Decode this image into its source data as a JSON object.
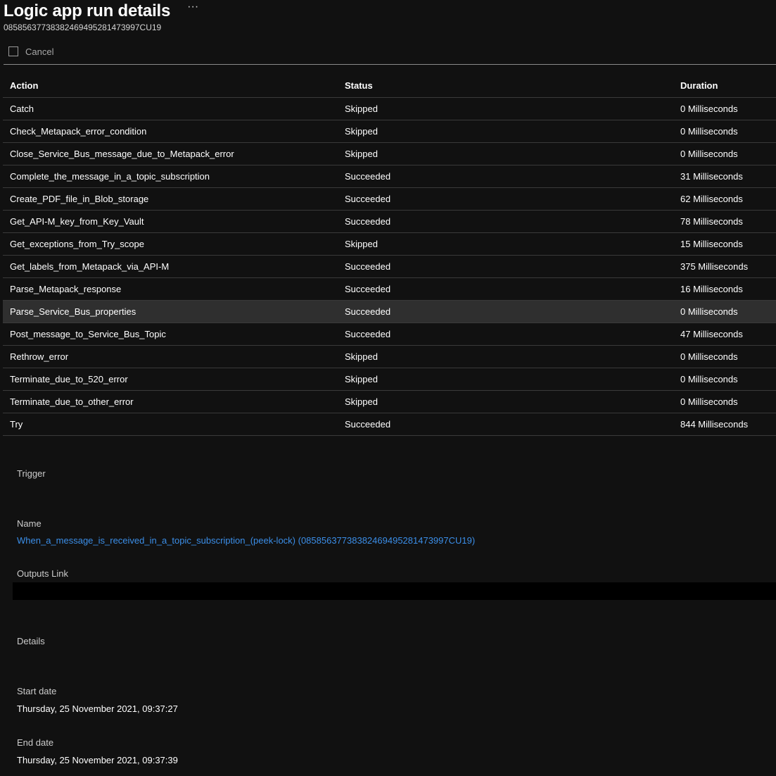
{
  "header": {
    "title": "Logic app run details",
    "more_label": "···",
    "run_id": "08585637738382469495281473997CU19"
  },
  "toolbar": {
    "cancel_label": "Cancel"
  },
  "table": {
    "columns": [
      "Action",
      "Status",
      "Duration"
    ],
    "rows": [
      {
        "action": "Catch",
        "status": "Skipped",
        "duration": "0 Milliseconds"
      },
      {
        "action": "Check_Metapack_error_condition",
        "status": "Skipped",
        "duration": "0 Milliseconds"
      },
      {
        "action": "Close_Service_Bus_message_due_to_Metapack_error",
        "status": "Skipped",
        "duration": "0 Milliseconds"
      },
      {
        "action": "Complete_the_message_in_a_topic_subscription",
        "status": "Succeeded",
        "duration": "31 Milliseconds"
      },
      {
        "action": "Create_PDF_file_in_Blob_storage",
        "status": "Succeeded",
        "duration": "62 Milliseconds"
      },
      {
        "action": "Get_API-M_key_from_Key_Vault",
        "status": "Succeeded",
        "duration": "78 Milliseconds"
      },
      {
        "action": "Get_exceptions_from_Try_scope",
        "status": "Skipped",
        "duration": "15 Milliseconds"
      },
      {
        "action": "Get_labels_from_Metapack_via_API-M",
        "status": "Succeeded",
        "duration": "375 Milliseconds"
      },
      {
        "action": "Parse_Metapack_response",
        "status": "Succeeded",
        "duration": "16 Milliseconds"
      },
      {
        "action": "Parse_Service_Bus_properties",
        "status": "Succeeded",
        "duration": "0 Milliseconds"
      },
      {
        "action": "Post_message_to_Service_Bus_Topic",
        "status": "Succeeded",
        "duration": "47 Milliseconds"
      },
      {
        "action": "Rethrow_error",
        "status": "Skipped",
        "duration": "0 Milliseconds"
      },
      {
        "action": "Terminate_due_to_520_error",
        "status": "Skipped",
        "duration": "0 Milliseconds"
      },
      {
        "action": "Terminate_due_to_other_error",
        "status": "Skipped",
        "duration": "0 Milliseconds"
      },
      {
        "action": "Try",
        "status": "Succeeded",
        "duration": "844 Milliseconds"
      }
    ]
  },
  "trigger": {
    "section_label": "Trigger",
    "name_label": "Name",
    "name_value": "When_a_message_is_received_in_a_topic_subscription_(peek-lock) (08585637738382469495281473997CU19)",
    "outputs_label": "Outputs Link"
  },
  "details": {
    "section_label": "Details",
    "start_label": "Start date",
    "start_value": "Thursday, 25 November 2021, 09:37:27",
    "end_label": "End date",
    "end_value": "Thursday, 25 November 2021, 09:37:39"
  },
  "colors": {
    "background": "#111111",
    "link": "#3b8ee8",
    "row_highlight": "#2f2f2f"
  }
}
